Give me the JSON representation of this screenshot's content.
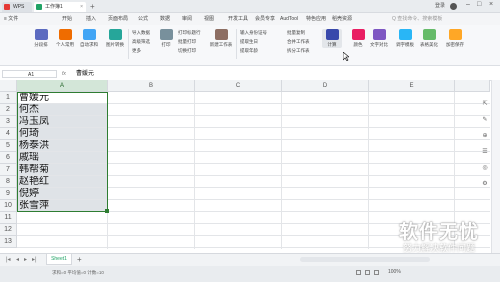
{
  "titlebar": {
    "tabs": [
      {
        "label": "WPS"
      },
      {
        "label": "工作簿1"
      }
    ],
    "user": "登录",
    "new_tab": "+"
  },
  "menubar": {
    "file": "≡ 文件",
    "items": [
      "开始",
      "插入",
      "页面布局",
      "公式",
      "数据",
      "审阅",
      "视图",
      "开发工具",
      "会员专享",
      "AudTool",
      "特色应用",
      "稻壳资源"
    ],
    "active_tool": "智能工具箱",
    "search": "Q 查找命令、搜索模板"
  },
  "ribbon": {
    "buttons": [
      {
        "label": "分段排"
      },
      {
        "label": "个人常用"
      },
      {
        "label": "自动求和"
      },
      {
        "label": "图片转换"
      },
      {
        "label": "打印"
      },
      {
        "label": "新建工作表"
      },
      {
        "label": "计算"
      },
      {
        "label": "颜色"
      },
      {
        "label": "文字对比"
      },
      {
        "label": "调字模板"
      },
      {
        "label": "表格美化"
      },
      {
        "label": "加密保存"
      }
    ],
    "small": [
      "导入数据",
      "高级筛选",
      "更多",
      "打印标题行",
      "批量打印",
      "切换打印",
      "输入身份证号",
      "提取生日",
      "提取年龄",
      "批量复制",
      "合并工作表",
      "拆分工作表"
    ]
  },
  "formula": {
    "cell_ref": "A1",
    "fx": "fx",
    "value": "曹媛元"
  },
  "grid": {
    "columns": [
      "A",
      "B",
      "C",
      "D",
      "E"
    ],
    "rows": [
      "1",
      "2",
      "3",
      "4",
      "5",
      "6",
      "7",
      "8",
      "9",
      "10",
      "11",
      "12",
      "13"
    ],
    "names": [
      "曹媛元",
      "何杰",
      "冯玉凤",
      "何琦",
      "杨泰洪",
      "戚瑶",
      "韩帮菊",
      "赵艳红",
      "倪婷",
      "张雪萍"
    ]
  },
  "sheets": {
    "active": "Sheet1",
    "add": "+"
  },
  "status": {
    "left": "求和=0  平均值=0  计数=10",
    "zoom": "100%"
  },
  "watermark": {
    "title": "软件无忧",
    "subtitle": "努力解决软件问题"
  },
  "colors": {
    "accent": "#21a366",
    "selection": "#2e7d32",
    "tab_active": "#ffffff"
  }
}
